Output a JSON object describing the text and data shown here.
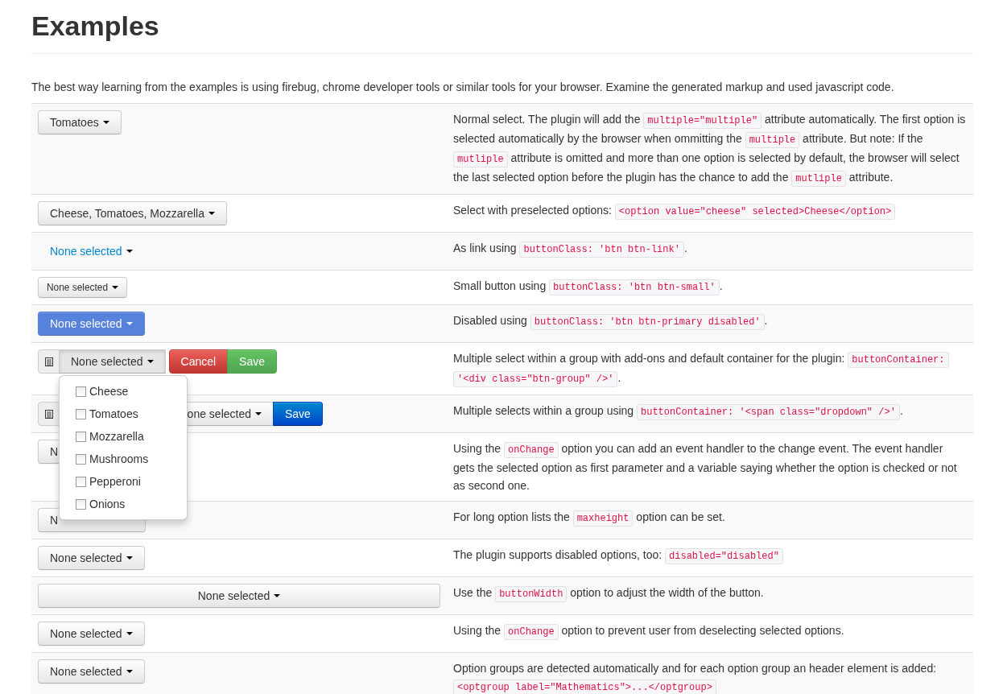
{
  "title": "Examples",
  "intro": "The best way learning from the examples is using firebug, chrome developer tools or similar tools for your browser. Examine the generated markup and used javascript code.",
  "rows": [
    {
      "control": {
        "kind": "default",
        "label": "Tomatoes",
        "disabled": false
      },
      "description": [
        {
          "kind": "text",
          "text": "Normal select. The plugin will add the "
        },
        {
          "kind": "code",
          "text": "multiple=\"multiple\""
        },
        {
          "kind": "text",
          "text": " attribute automatically. The first option is selected automatically by the browser when ommitting the "
        },
        {
          "kind": "code",
          "text": "multiple"
        },
        {
          "kind": "text",
          "text": " attribute. But note: If the "
        },
        {
          "kind": "code",
          "text": "mutliple"
        },
        {
          "kind": "text",
          "text": " attribute is omitted and more than one option is selected by default, the browser will select the last selected option before the plugin has the chance to add the "
        },
        {
          "kind": "code",
          "text": "mutliple"
        },
        {
          "kind": "text",
          "text": " attribute."
        }
      ]
    },
    {
      "control": {
        "kind": "default",
        "label": "Cheese, Tomatoes, Mozzarella",
        "disabled": false
      },
      "description": [
        {
          "kind": "text",
          "text": "Select with preselected options: "
        },
        {
          "kind": "code",
          "text": "<option value=\"cheese\" selected>Cheese</option>"
        }
      ]
    },
    {
      "control": {
        "kind": "link",
        "label": "None selected",
        "disabled": false
      },
      "description": [
        {
          "kind": "text",
          "text": "As link using "
        },
        {
          "kind": "code",
          "text": "buttonClass: 'btn btn-link'"
        },
        {
          "kind": "text",
          "text": "."
        }
      ]
    },
    {
      "control": {
        "kind": "small",
        "label": "None selected",
        "disabled": false
      },
      "description": [
        {
          "kind": "text",
          "text": "Small button using "
        },
        {
          "kind": "code",
          "text": "buttonClass: 'btn btn-small'"
        },
        {
          "kind": "text",
          "text": "."
        }
      ]
    },
    {
      "control": {
        "kind": "primary",
        "label": "None selected",
        "disabled": true
      },
      "description": [
        {
          "kind": "text",
          "text": "Disabled using "
        },
        {
          "kind": "code",
          "text": "buttonClass: 'btn btn-primary disabled'"
        },
        {
          "kind": "text",
          "text": "."
        }
      ]
    },
    {
      "control": {
        "kind": "group",
        "items": [
          {
            "kind": "addon"
          },
          {
            "kind": "toggle",
            "label": "None selected",
            "expanded": true
          },
          {
            "kind": "danger",
            "label": "Cancel"
          },
          {
            "kind": "success",
            "label": "Save"
          }
        ]
      },
      "description": [
        {
          "kind": "text",
          "text": "Multiple select within a group with add-ons and default container for the plugin: "
        },
        {
          "kind": "code",
          "text": "buttonContainer: '<div class=\"btn-group\" />'"
        },
        {
          "kind": "text",
          "text": "."
        }
      ]
    },
    {
      "control": {
        "kind": "group",
        "items": [
          {
            "kind": "addon"
          },
          {
            "kind": "covered-toggle",
            "label": "one selected",
            "expanded": false
          },
          {
            "kind": "primary",
            "label": "Save"
          }
        ]
      },
      "description": [
        {
          "kind": "text",
          "text": "Multiple selects within a group using "
        },
        {
          "kind": "code",
          "text": "buttonContainer: '<span class=\"dropdown\" />'"
        },
        {
          "kind": "text",
          "text": "."
        }
      ]
    },
    {
      "control": {
        "kind": "covered",
        "label": "N",
        "disabled": false
      },
      "description": [
        {
          "kind": "text",
          "text": "Using the "
        },
        {
          "kind": "code",
          "text": "onChange"
        },
        {
          "kind": "text",
          "text": " option you can add an event handler to the change event. The event handler gets the selected option as first parameter and a variable saying whether the option is checked or not as second one."
        }
      ]
    },
    {
      "control": {
        "kind": "covered",
        "label": "N",
        "disabled": false
      },
      "description": [
        {
          "kind": "text",
          "text": "For long option lists the "
        },
        {
          "kind": "code",
          "text": "maxheight"
        },
        {
          "kind": "text",
          "text": " option can be set."
        }
      ]
    },
    {
      "control": {
        "kind": "default",
        "label": "None selected",
        "disabled": false
      },
      "description": [
        {
          "kind": "text",
          "text": "The plugin supports disabled options, too: "
        },
        {
          "kind": "code",
          "text": "disabled=\"disabled\""
        }
      ]
    },
    {
      "control": {
        "kind": "block",
        "label": "None selected",
        "disabled": false
      },
      "description": [
        {
          "kind": "text",
          "text": "Use the "
        },
        {
          "kind": "code",
          "text": "buttonWidth"
        },
        {
          "kind": "text",
          "text": " option to adjust the width of the button."
        }
      ]
    },
    {
      "control": {
        "kind": "default",
        "label": "None selected",
        "disabled": false
      },
      "description": [
        {
          "kind": "text",
          "text": "Using the "
        },
        {
          "kind": "code",
          "text": "onChange"
        },
        {
          "kind": "text",
          "text": " option to prevent user from deselecting selected options."
        }
      ]
    },
    {
      "control": {
        "kind": "default",
        "label": "None selected",
        "disabled": false
      },
      "description": [
        {
          "kind": "text",
          "text": "Option groups are detected automatically and for each option group an header element is added: "
        },
        {
          "kind": "code",
          "text": "<optgroup label=\"Mathematics\">...</optgroup>"
        }
      ]
    }
  ],
  "dropdown": {
    "options": [
      {
        "label": "Cheese",
        "checked": false
      },
      {
        "label": "Tomatoes",
        "checked": false
      },
      {
        "label": "Mozzarella",
        "checked": false
      },
      {
        "label": "Mushrooms",
        "checked": false
      },
      {
        "label": "Pepperoni",
        "checked": false
      },
      {
        "label": "Onions",
        "checked": false
      }
    ]
  }
}
